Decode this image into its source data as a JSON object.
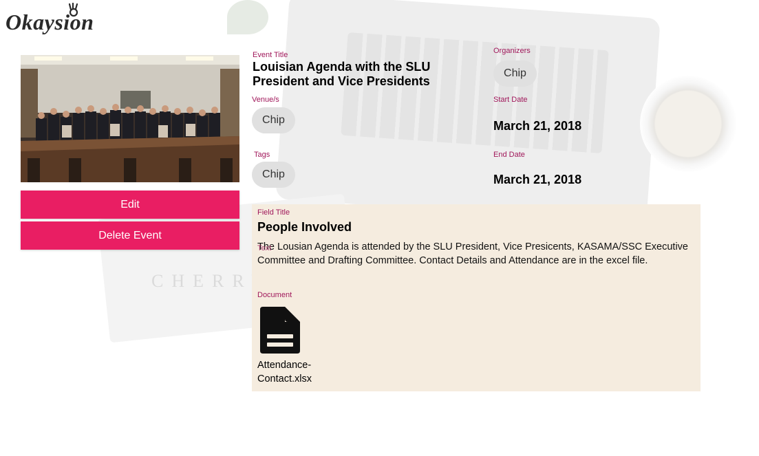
{
  "brand": {
    "logo_text": "Okaysion"
  },
  "actions": {
    "edit_label": "Edit",
    "delete_label": "Delete Event"
  },
  "event": {
    "title_label": "Event Title",
    "title_line1": "Louisian Agenda with the SLU",
    "title_line2": "President and Vice Presidents",
    "venue_label": "Venue/s",
    "venue_chip": "Chip",
    "tags_label": "Tags",
    "tags_chip": "Chip",
    "organizers_label": "Organizers",
    "organizers_chip": "Chip",
    "start_label": "Start Date",
    "start_date": "March 21, 2018",
    "end_label": "End Date",
    "end_date": "March 21, 2018"
  },
  "field": {
    "title_label": "Field Title",
    "title": "People Involved",
    "text_label": "Text",
    "text": "The Lousian Agenda is attended by the SLU President, Vice Presicents, KASAMA/SSC Executive Committee and Drafting Committee. Contact Details and Attendance are in the excel file.",
    "document_label": "Document",
    "document_icon": "file-document-icon",
    "document_name": "Attendance-Contact.xlsx"
  },
  "colors": {
    "accent": "#e91e63",
    "label": "#a0175a",
    "panel": "#f5ecdf",
    "chip": "#e0e0e0"
  }
}
